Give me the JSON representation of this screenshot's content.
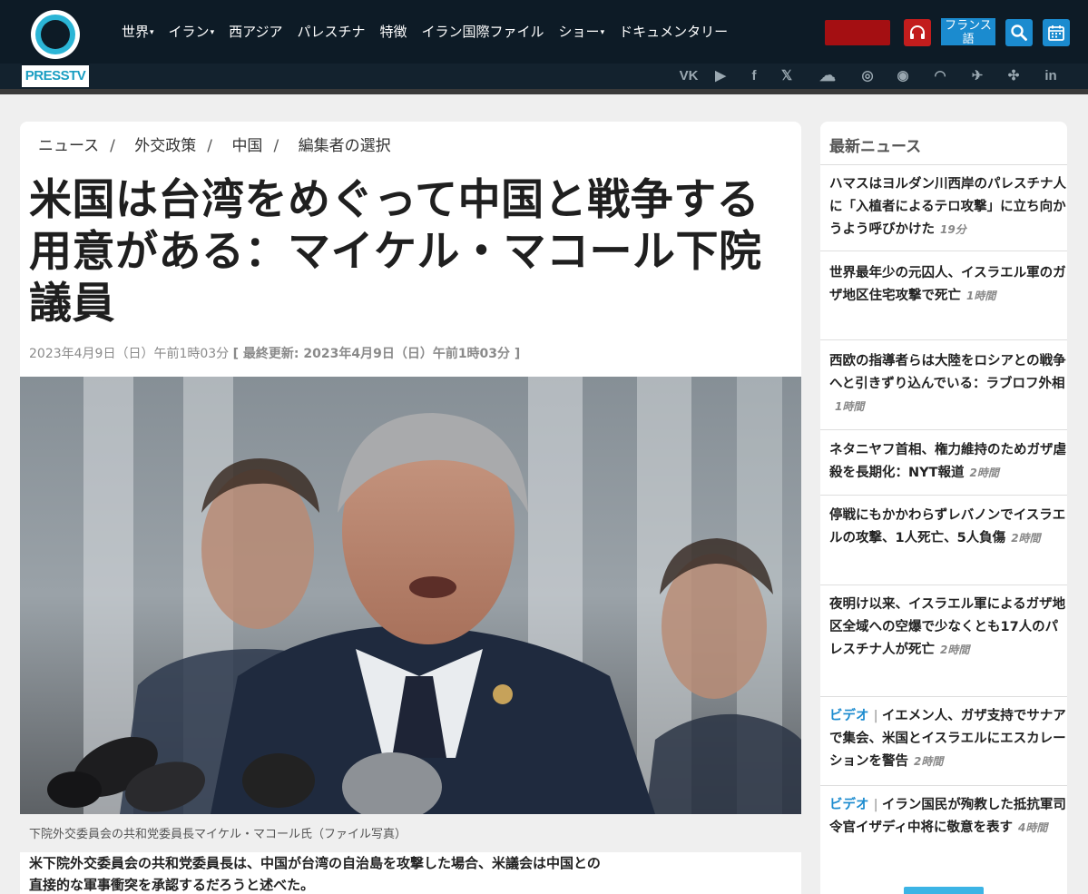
{
  "brand": {
    "logo_text": "PRESSTV"
  },
  "nav": [
    {
      "label": "世界",
      "caret": true
    },
    {
      "label": "イラン",
      "caret": true
    },
    {
      "label": "西アジア",
      "caret": false
    },
    {
      "label": "パレスチナ",
      "caret": false
    },
    {
      "label": "特徴",
      "caret": false
    },
    {
      "label": "イラン国際ファイル",
      "caret": false
    },
    {
      "label": "ショー",
      "caret": true
    },
    {
      "label": "ドキュメンタリー",
      "caret": false
    }
  ],
  "header_buttons": {
    "language_label": "フランス語"
  },
  "social": [
    {
      "name": "vk-icon",
      "glyph": "VK"
    },
    {
      "name": "rumble-icon",
      "glyph": "▶"
    },
    {
      "name": "facebook-icon",
      "glyph": "f"
    },
    {
      "name": "x-icon",
      "glyph": "𝕏"
    },
    {
      "name": "soundcloud-icon",
      "glyph": "☁"
    },
    {
      "name": "instagram-icon",
      "glyph": "◎"
    },
    {
      "name": "odysee-icon",
      "glyph": "◉"
    },
    {
      "name": "rss-icon",
      "glyph": "◠"
    },
    {
      "name": "telegram-icon",
      "glyph": "✈"
    },
    {
      "name": "shortwave-icon",
      "glyph": "✣"
    },
    {
      "name": "linkedin-icon",
      "glyph": "in"
    }
  ],
  "colors": {
    "header": "#0d1b26",
    "accent": "#1b8bcf",
    "live": "#a40f12",
    "podcast": "#c21d1d"
  },
  "article": {
    "breadcrumb": [
      "ニュース",
      "外交政策",
      "中国",
      "編集者の選択"
    ],
    "headline": "米国は台湾をめぐって中国と戦争する用意がある：マイケル・マコール下院議員",
    "published": "2023年4月9日（日）午前1時03分",
    "updated": "[ 最終更新: 2023年4月9日（日）午前1時03分 ]",
    "image_caption": "下院外交委員会の共和党委員長マイケル・マコール氏（ファイル写真）",
    "lead": "米下院外交委員会の共和党委員長は、中国が台湾の自治島を攻撃した場合、米議会は中国との直接的な軍事衝突を承認するだろうと述べた。"
  },
  "sidebar": {
    "title": "最新ニュース",
    "items": [
      {
        "video": "",
        "text": "ハマスはヨルダン川西岸のパレスチナ人に「入植者によるテロ攻撃」に立ち向かうよう呼びかけた",
        "time": "19分"
      },
      {
        "video": "",
        "text": "世界最年少の元囚人、イスラエル軍のガザ地区住宅攻撃で死亡",
        "time": "1時間"
      },
      {
        "video": "",
        "text": "西欧の指導者らは大陸をロシアとの戦争へと引きずり込んでいる：ラブロフ外相",
        "time": "1時間"
      },
      {
        "video": "",
        "text": "ネタニヤフ首相、権力維持のためガザ虐殺を長期化：NYT報道",
        "time": "2時間"
      },
      {
        "video": "",
        "text": "停戦にもかかわらずレバノンでイスラエルの攻撃、1人死亡、5人負傷",
        "time": "2時間"
      },
      {
        "video": "",
        "text": "夜明け以来、イスラエル軍によるガザ地区全域への空爆で少なくとも17人のパレスチナ人が死亡",
        "time": "2時間"
      },
      {
        "video": "ビデオ",
        "text": "イエメン人、ガザ支持でサナアで集会、米国とイスラエルにエスカレーションを警告",
        "time": "2時間"
      },
      {
        "video": "ビデオ",
        "text": "イラン国民が殉教した抵抗軍司令官イザディ中将に敬意を表す",
        "time": "4時間"
      }
    ]
  }
}
